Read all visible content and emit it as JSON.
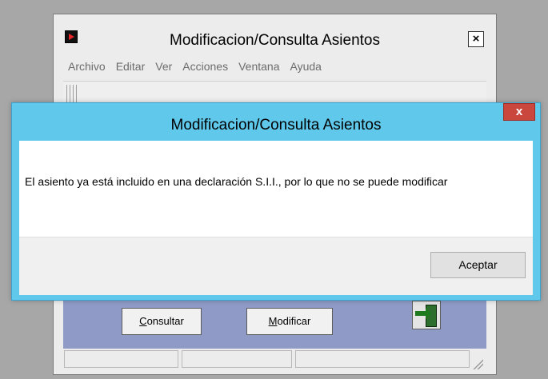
{
  "app": {
    "title": "Modificacion/Consulta Asientos",
    "close_label": "×",
    "menu": [
      "Archivo",
      "Editar",
      "Ver",
      "Acciones",
      "Ventana",
      "Ayuda"
    ],
    "buttons": {
      "consultar": {
        "mnemonic": "C",
        "rest": "onsultar"
      },
      "modificar": {
        "mnemonic": "M",
        "rest": "odificar"
      }
    },
    "exit_icon": "exit-door-icon"
  },
  "dialog": {
    "title": "Modificacion/Consulta Asientos",
    "close_label": "x",
    "message": "El asiento ya está incluido en una declaración S.I.I., por lo que no se puede modificar",
    "accept_label": "Aceptar"
  },
  "colors": {
    "dialog_frame": "#60c8eb",
    "close_button": "#c9473d",
    "app_panel": "#8f9bc6"
  }
}
